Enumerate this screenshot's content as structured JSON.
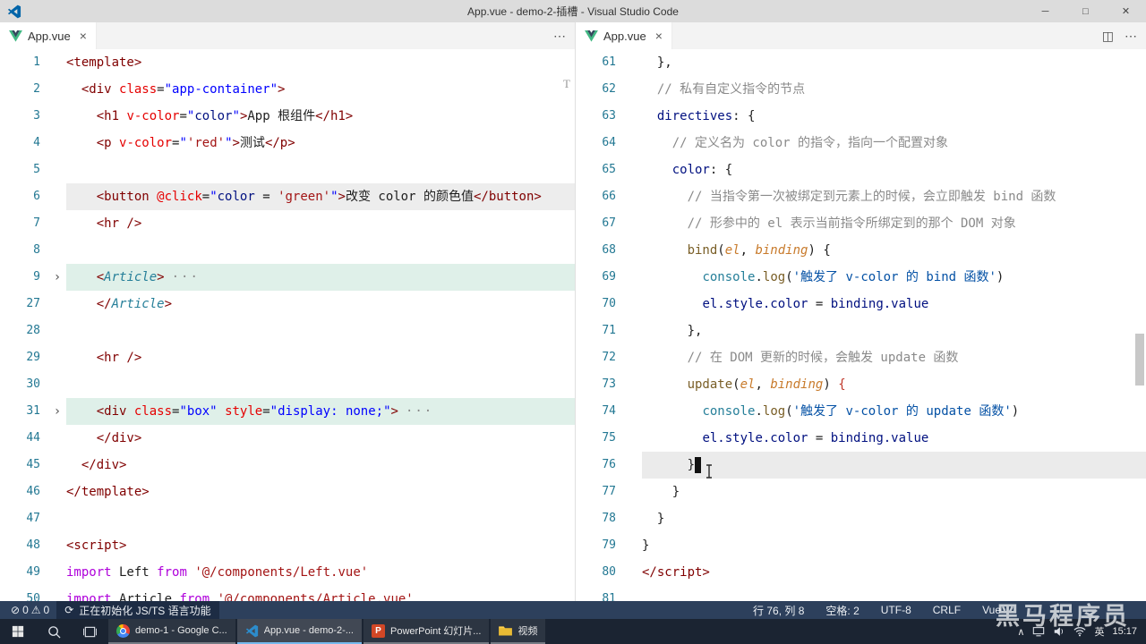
{
  "window": {
    "title": "App.vue - demo-2-插槽 - Visual Studio Code",
    "controls": {
      "minimize": "─",
      "restore": "□",
      "close": "✕"
    }
  },
  "icons": {
    "close_tab": "×",
    "more": "⋯",
    "split_editor": "◫",
    "error": "⊘",
    "warning": "⚠",
    "sync": "⟳",
    "fold_collapsed": "›",
    "folded_badge": "···",
    "tray_chevron": "∧",
    "ppt_glyph": "P"
  },
  "colors": {
    "titlebar_bg": "#dcdcdc",
    "statusbar_bg": "#2d405c",
    "taskbar_bg": "#1b2432",
    "vscode_blue": "#0065a9",
    "vue_green": "#41b883",
    "line_number": "#237893",
    "tag": "#800000",
    "attribute": "#e50000",
    "attr_value": "#0000ff",
    "string": "#a31515",
    "string_alt": "#0451a5",
    "keyword": "#af00db",
    "function": "#795e26",
    "parameter": "#c87a2b",
    "comment": "#8a8a8a",
    "variable": "#001080"
  },
  "editor_decoration": "T",
  "editor_groups": [
    {
      "tab": {
        "label": "App.vue"
      },
      "lines": [
        {
          "n": 1,
          "tokens": [
            {
              "t": "<template>",
              "c": "tag"
            }
          ]
        },
        {
          "n": 2,
          "tokens": [
            {
              "t": "  "
            },
            {
              "t": "<div",
              "c": "tag"
            },
            {
              "t": " "
            },
            {
              "t": "class",
              "c": "attr"
            },
            {
              "t": "=",
              "c": "pln"
            },
            {
              "t": "\"app-container\"",
              "c": "aval"
            },
            {
              "t": ">",
              "c": "tag"
            }
          ]
        },
        {
          "n": 3,
          "tokens": [
            {
              "t": "    "
            },
            {
              "t": "<h1",
              "c": "tag"
            },
            {
              "t": " "
            },
            {
              "t": "v-color",
              "c": "attr"
            },
            {
              "t": "=",
              "c": "pln"
            },
            {
              "t": "\"",
              "c": "aval"
            },
            {
              "t": "color",
              "c": "var"
            },
            {
              "t": "\"",
              "c": "aval"
            },
            {
              "t": ">",
              "c": "tag"
            },
            {
              "t": "App 根组件",
              "c": "pln"
            },
            {
              "t": "</h1>",
              "c": "tag"
            }
          ]
        },
        {
          "n": 4,
          "tokens": [
            {
              "t": "    "
            },
            {
              "t": "<p",
              "c": "tag"
            },
            {
              "t": " "
            },
            {
              "t": "v-color",
              "c": "attr"
            },
            {
              "t": "=",
              "c": "pln"
            },
            {
              "t": "\"",
              "c": "aval"
            },
            {
              "t": "'red'",
              "c": "str"
            },
            {
              "t": "\"",
              "c": "aval"
            },
            {
              "t": ">",
              "c": "tag"
            },
            {
              "t": "测试",
              "c": "pln"
            },
            {
              "t": "</p>",
              "c": "tag"
            }
          ]
        },
        {
          "n": 5,
          "tokens": []
        },
        {
          "n": 6,
          "hl": "gray",
          "tokens": [
            {
              "t": "    "
            },
            {
              "t": "<button",
              "c": "tag"
            },
            {
              "t": " "
            },
            {
              "t": "@click",
              "c": "attr"
            },
            {
              "t": "=",
              "c": "pln"
            },
            {
              "t": "\"",
              "c": "aval"
            },
            {
              "t": "color",
              "c": "var"
            },
            {
              "t": " = ",
              "c": "pln"
            },
            {
              "t": "'green'",
              "c": "str"
            },
            {
              "t": "\"",
              "c": "aval"
            },
            {
              "t": ">",
              "c": "tag"
            },
            {
              "t": "改变 color 的颜色值",
              "c": "pln"
            },
            {
              "t": "</button>",
              "c": "tag"
            }
          ]
        },
        {
          "n": 7,
          "tokens": [
            {
              "t": "    "
            },
            {
              "t": "<hr />",
              "c": "tag"
            }
          ]
        },
        {
          "n": 8,
          "tokens": []
        },
        {
          "n": 9,
          "hl": "teal",
          "fold": true,
          "badge": true,
          "tokens": [
            {
              "t": "    "
            },
            {
              "t": "<",
              "c": "tag"
            },
            {
              "t": "Article",
              "c": "cmp"
            },
            {
              "t": ">",
              "c": "tag"
            }
          ]
        },
        {
          "n": 27,
          "tokens": [
            {
              "t": "    "
            },
            {
              "t": "</",
              "c": "tag"
            },
            {
              "t": "Article",
              "c": "cmp"
            },
            {
              "t": ">",
              "c": "tag"
            }
          ]
        },
        {
          "n": 28,
          "tokens": []
        },
        {
          "n": 29,
          "tokens": [
            {
              "t": "    "
            },
            {
              "t": "<hr />",
              "c": "tag"
            }
          ]
        },
        {
          "n": 30,
          "tokens": []
        },
        {
          "n": 31,
          "hl": "teal",
          "fold": true,
          "badge": true,
          "tokens": [
            {
              "t": "    "
            },
            {
              "t": "<div",
              "c": "tag"
            },
            {
              "t": " "
            },
            {
              "t": "class",
              "c": "attr"
            },
            {
              "t": "=",
              "c": "pln"
            },
            {
              "t": "\"box\"",
              "c": "aval"
            },
            {
              "t": " "
            },
            {
              "t": "style",
              "c": "attr"
            },
            {
              "t": "=",
              "c": "pln"
            },
            {
              "t": "\"display: none;\"",
              "c": "aval"
            },
            {
              "t": ">",
              "c": "tag"
            }
          ]
        },
        {
          "n": 44,
          "tokens": [
            {
              "t": "    "
            },
            {
              "t": "</div>",
              "c": "tag"
            }
          ]
        },
        {
          "n": 45,
          "tokens": [
            {
              "t": "  "
            },
            {
              "t": "</div>",
              "c": "tag"
            }
          ]
        },
        {
          "n": 46,
          "tokens": [
            {
              "t": "</template>",
              "c": "tag"
            }
          ]
        },
        {
          "n": 47,
          "tokens": []
        },
        {
          "n": 48,
          "tokens": [
            {
              "t": "<script>",
              "c": "tag"
            }
          ]
        },
        {
          "n": 49,
          "tokens": [
            {
              "t": "import",
              "c": "kw"
            },
            {
              "t": " Left ",
              "c": "pln"
            },
            {
              "t": "from",
              "c": "kw"
            },
            {
              "t": " ",
              "c": "pln"
            },
            {
              "t": "'@/components/Left.vue'",
              "c": "str"
            }
          ]
        },
        {
          "n": 50,
          "tokens": [
            {
              "t": "import",
              "c": "kw"
            },
            {
              "t": " Article ",
              "c": "pln"
            },
            {
              "t": "from",
              "c": "kw"
            },
            {
              "t": " ",
              "c": "pln"
            },
            {
              "t": "'@/components/Article.vue'",
              "c": "str"
            }
          ]
        }
      ]
    },
    {
      "tab": {
        "label": "App.vue"
      },
      "lines": [
        {
          "n": 61,
          "tokens": [
            {
              "t": "  },",
              "c": "pln"
            }
          ]
        },
        {
          "n": 62,
          "tokens": [
            {
              "t": "  "
            },
            {
              "t": "// 私有自定义指令的节点",
              "c": "cmt"
            }
          ]
        },
        {
          "n": 63,
          "tokens": [
            {
              "t": "  "
            },
            {
              "t": "directives",
              "c": "var"
            },
            {
              "t": ": {",
              "c": "pln"
            }
          ]
        },
        {
          "n": 64,
          "tokens": [
            {
              "t": "    "
            },
            {
              "t": "// 定义名为 color 的指令，指向一个配置对象",
              "c": "cmt"
            }
          ]
        },
        {
          "n": 65,
          "tokens": [
            {
              "t": "    "
            },
            {
              "t": "color",
              "c": "var"
            },
            {
              "t": ": {",
              "c": "pln"
            }
          ]
        },
        {
          "n": 66,
          "tokens": [
            {
              "t": "      "
            },
            {
              "t": "// 当指令第一次被绑定到元素上的时候，会立即触发 bind 函数",
              "c": "cmt"
            }
          ]
        },
        {
          "n": 67,
          "tokens": [
            {
              "t": "      "
            },
            {
              "t": "// 形参中的 el 表示当前指令所绑定到的那个 DOM 对象",
              "c": "cmt"
            }
          ]
        },
        {
          "n": 68,
          "tokens": [
            {
              "t": "      "
            },
            {
              "t": "bind",
              "c": "fn"
            },
            {
              "t": "(",
              "c": "pln"
            },
            {
              "t": "el",
              "c": "par"
            },
            {
              "t": ", ",
              "c": "pln"
            },
            {
              "t": "binding",
              "c": "par"
            },
            {
              "t": ") {",
              "c": "pln"
            }
          ]
        },
        {
          "n": 69,
          "tokens": [
            {
              "t": "        "
            },
            {
              "t": "console",
              "c": "cls"
            },
            {
              "t": ".",
              "c": "pln"
            },
            {
              "t": "log",
              "c": "fn"
            },
            {
              "t": "(",
              "c": "pln"
            },
            {
              "t": "'触发了 v-color 的 bind 函数'",
              "c": "str2"
            },
            {
              "t": ")",
              "c": "pln"
            }
          ]
        },
        {
          "n": 70,
          "tokens": [
            {
              "t": "        "
            },
            {
              "t": "el.style.color",
              "c": "var"
            },
            {
              "t": " = ",
              "c": "pln"
            },
            {
              "t": "binding.value",
              "c": "var"
            }
          ]
        },
        {
          "n": 71,
          "tokens": [
            {
              "t": "      },",
              "c": "pln"
            }
          ]
        },
        {
          "n": 72,
          "tokens": [
            {
              "t": "      "
            },
            {
              "t": "// 在 DOM 更新的时候，会触发 update 函数",
              "c": "cmt"
            }
          ]
        },
        {
          "n": 73,
          "tokens": [
            {
              "t": "      "
            },
            {
              "t": "update",
              "c": "fn"
            },
            {
              "t": "(",
              "c": "pln"
            },
            {
              "t": "el",
              "c": "par"
            },
            {
              "t": ", ",
              "c": "pln"
            },
            {
              "t": "binding",
              "c": "par"
            },
            {
              "t": ") ",
              "c": "pln"
            },
            {
              "t": "{",
              "c": "brhl"
            }
          ]
        },
        {
          "n": 74,
          "tokens": [
            {
              "t": "        "
            },
            {
              "t": "console",
              "c": "cls"
            },
            {
              "t": ".",
              "c": "pln"
            },
            {
              "t": "log",
              "c": "fn"
            },
            {
              "t": "(",
              "c": "pln"
            },
            {
              "t": "'触发了 v-color 的 update 函数'",
              "c": "str2"
            },
            {
              "t": ")",
              "c": "pln"
            }
          ]
        },
        {
          "n": 75,
          "tokens": [
            {
              "t": "        "
            },
            {
              "t": "el.style.color",
              "c": "var"
            },
            {
              "t": " = ",
              "c": "pln"
            },
            {
              "t": "binding.value",
              "c": "var"
            }
          ]
        },
        {
          "n": 76,
          "hl": "cur",
          "cursor": true,
          "tokens": [
            {
              "t": "      "
            },
            {
              "t": "}",
              "c": "pln"
            }
          ]
        },
        {
          "n": 77,
          "tokens": [
            {
              "t": "    }",
              "c": "pln"
            }
          ]
        },
        {
          "n": 78,
          "tokens": [
            {
              "t": "  }",
              "c": "pln"
            }
          ]
        },
        {
          "n": 79,
          "tokens": [
            {
              "t": "}",
              "c": "pln"
            }
          ]
        },
        {
          "n": 80,
          "tokens": [
            {
              "t": "</script>",
              "c": "tag"
            }
          ]
        },
        {
          "n": 81,
          "tokens": []
        }
      ]
    }
  ],
  "status_bar": {
    "problems": {
      "errors": "0",
      "warnings": "0"
    },
    "progress": {
      "text": "正在初始化 JS/TS 语言功能"
    },
    "right": [
      "行 76, 列 8",
      "空格: 2",
      "UTF-8",
      "CRLF",
      "Vue"
    ]
  },
  "taskbar": {
    "apps": [
      {
        "label": "demo-1 - Google C..."
      },
      {
        "label": "App.vue - demo-2-..."
      },
      {
        "label": "PowerPoint 幻灯片..."
      },
      {
        "label": "视频"
      }
    ],
    "tray": {
      "lang": "英",
      "time": "15:17"
    }
  },
  "watermark": {
    "text": "黑马程序员"
  }
}
